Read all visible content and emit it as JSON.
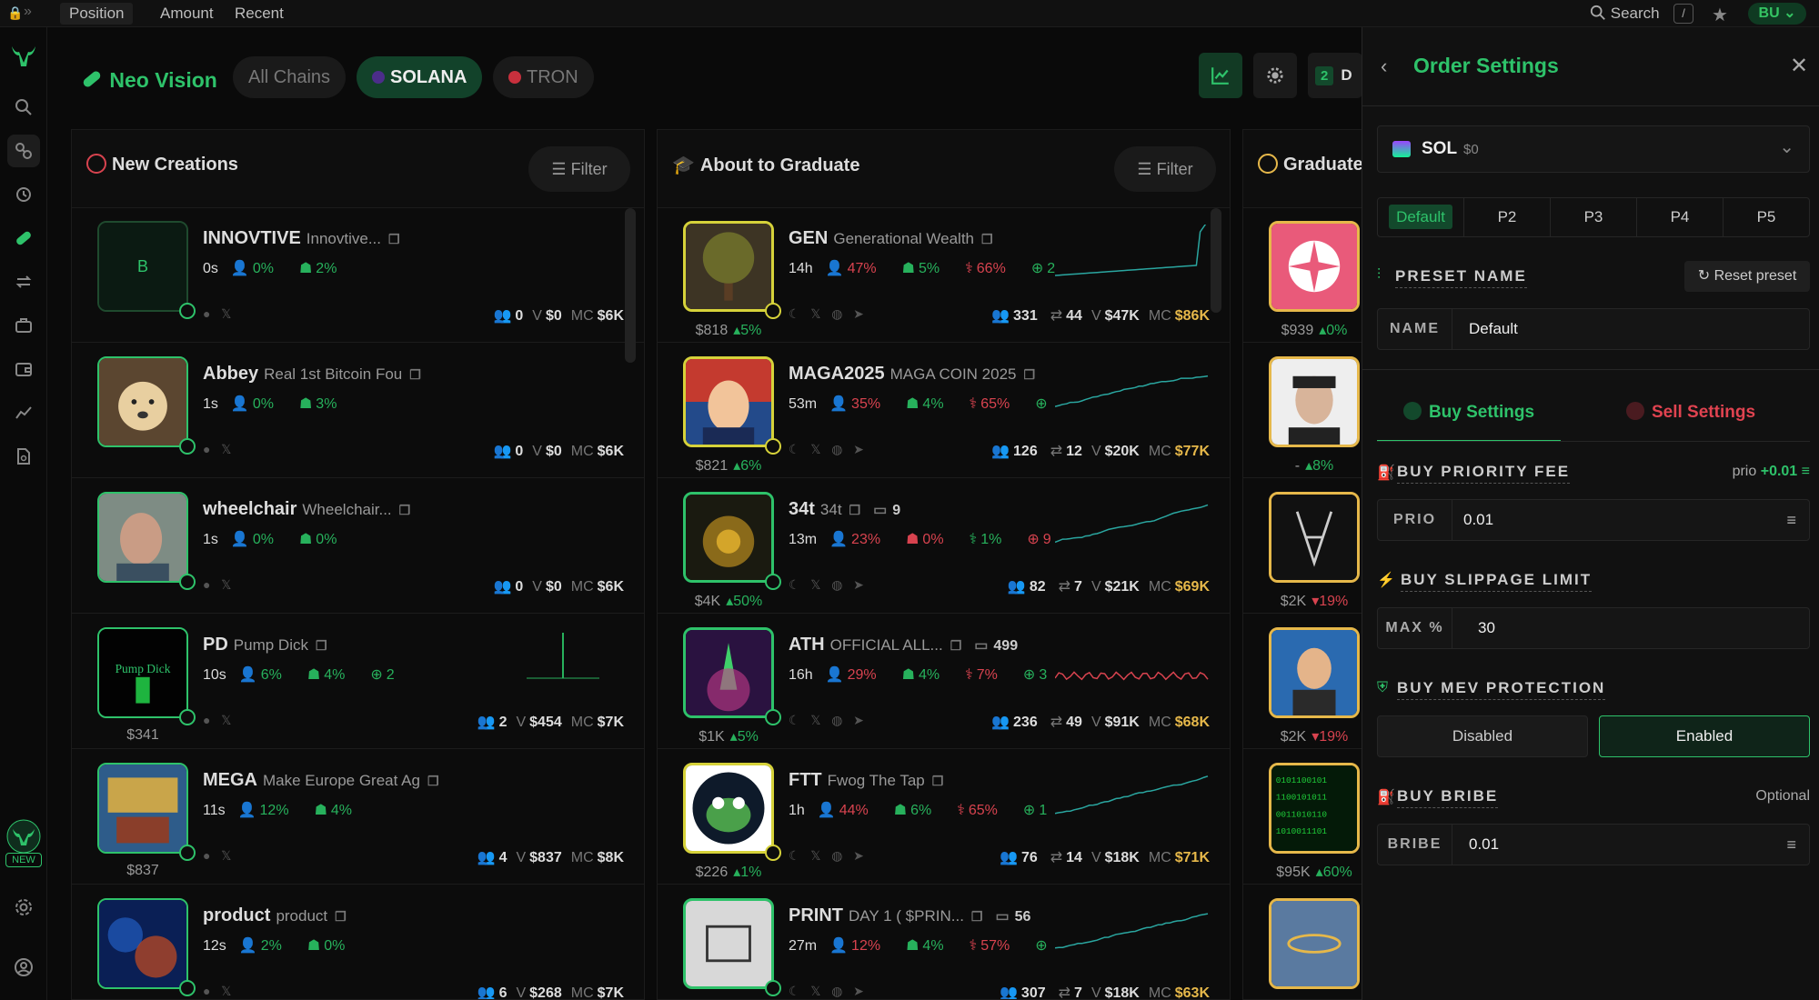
{
  "topbar": {
    "tabs": [
      "Position",
      "Amount",
      "Recent"
    ],
    "search_label": "Search",
    "search_shortcut": "/",
    "user_label": "BU"
  },
  "header": {
    "brand": "Neo Vision",
    "chains": [
      "All Chains",
      "SOLANA",
      "TRON"
    ],
    "count_badge": "2",
    "count_label": "D"
  },
  "columns": [
    {
      "title": "New Creations",
      "filter_label": "Filter"
    },
    {
      "title": "About to Graduate",
      "filter_label": "Filter"
    },
    {
      "title": "Graduate",
      "filter_label": ""
    }
  ],
  "new_creations": [
    {
      "symbol": "INNOVTIVE",
      "name": "Innovtive...",
      "age": "0s",
      "holders_pct": "0%",
      "dev_pct": "2%",
      "extra": "",
      "holders": "0",
      "volume": "$0",
      "mc": "$6K",
      "price": "",
      "avatar_letter": "B"
    },
    {
      "symbol": "Abbey",
      "name": "Real 1st Bitcoin Fou",
      "age": "1s",
      "holders_pct": "0%",
      "dev_pct": "3%",
      "extra": "",
      "holders": "0",
      "volume": "$0",
      "mc": "$6K",
      "price": "",
      "avatar_letter": ""
    },
    {
      "symbol": "wheelchair",
      "name": "Wheelchair...",
      "age": "1s",
      "holders_pct": "0%",
      "dev_pct": "0%",
      "extra": "",
      "holders": "0",
      "volume": "$0",
      "mc": "$6K",
      "price": "",
      "avatar_letter": ""
    },
    {
      "symbol": "PD",
      "name": "Pump Dick",
      "age": "10s",
      "holders_pct": "6%",
      "dev_pct": "4%",
      "extra": "2",
      "holders": "2",
      "volume": "$454",
      "mc": "$7K",
      "price": "$341",
      "avatar_letter": ""
    },
    {
      "symbol": "MEGA",
      "name": "Make Europe Great Ag",
      "age": "11s",
      "holders_pct": "12%",
      "dev_pct": "4%",
      "extra": "",
      "holders": "4",
      "volume": "$837",
      "mc": "$8K",
      "price": "$837",
      "avatar_letter": ""
    },
    {
      "symbol": "product",
      "name": "product",
      "age": "12s",
      "holders_pct": "2%",
      "dev_pct": "0%",
      "extra": "",
      "holders": "6",
      "volume": "$268",
      "mc": "$7K",
      "price": "",
      "avatar_letter": ""
    }
  ],
  "graduating": [
    {
      "symbol": "GEN",
      "name": "Generational Wealth",
      "age": "14h",
      "p1": "47%",
      "p2": "5%",
      "p3": "66%",
      "p4": "2",
      "holders": "331",
      "tx": "44",
      "volume": "$47K",
      "mc": "$86K",
      "price": "$818",
      "change": "5%"
    },
    {
      "symbol": "MAGA2025",
      "name": "MAGA COIN 2025",
      "age": "53m",
      "p1": "35%",
      "p2": "4%",
      "p3": "65%",
      "p4": "",
      "holders": "126",
      "tx": "12",
      "volume": "$20K",
      "mc": "$77K",
      "price": "$821",
      "change": "6%"
    },
    {
      "symbol": "34t",
      "name": "34t",
      "age": "13m",
      "p1": "23%",
      "p2": "0%",
      "p3": "1%",
      "p4": "9",
      "holders": "82",
      "tx": "7",
      "volume": "$21K",
      "mc": "$69K",
      "price": "$4K",
      "change": "50%",
      "comments": "9"
    },
    {
      "symbol": "ATH",
      "name": "OFFICIAL ALL...",
      "age": "16h",
      "p1": "29%",
      "p2": "4%",
      "p3": "7%",
      "p4": "3",
      "holders": "236",
      "tx": "49",
      "volume": "$91K",
      "mc": "$68K",
      "price": "$1K",
      "change": "5%",
      "comments": "499"
    },
    {
      "symbol": "FTT",
      "name": "Fwog The Tap",
      "age": "1h",
      "p1": "44%",
      "p2": "6%",
      "p3": "65%",
      "p4": "1",
      "holders": "76",
      "tx": "14",
      "volume": "$18K",
      "mc": "$71K",
      "price": "$226",
      "change": "1%"
    },
    {
      "symbol": "PRINT",
      "name": "DAY 1 ( $PRIN...",
      "age": "27m",
      "p1": "12%",
      "p2": "4%",
      "p3": "57%",
      "p4": "",
      "holders": "307",
      "tx": "7",
      "volume": "$18K",
      "mc": "$63K",
      "price": "",
      "change": "",
      "comments": "56"
    }
  ],
  "graduated": [
    {
      "price": "$939",
      "change": "0%"
    },
    {
      "price": "-",
      "change": "8%"
    },
    {
      "price": "$2K",
      "change": "19%"
    },
    {
      "price": "$2K",
      "change": "19%"
    },
    {
      "price": "$95K",
      "change": "60%"
    },
    {
      "price": "",
      "change": ""
    }
  ],
  "order_settings": {
    "title": "Order Settings",
    "token": {
      "symbol": "SOL",
      "balance": "$0"
    },
    "presets": [
      "Default",
      "P2",
      "P3",
      "P4",
      "P5"
    ],
    "preset_name_label": "PRESET NAME",
    "reset_label": "Reset preset",
    "name_label": "NAME",
    "name_value": "Default",
    "tabs": {
      "buy": "Buy Settings",
      "sell": "Sell Settings"
    },
    "priority": {
      "label": "BUY PRIORITY FEE",
      "hint": "prio",
      "hint_value": "+0.01",
      "field_label": "PRIO",
      "value": "0.01"
    },
    "slippage": {
      "label": "BUY SLIPPAGE LIMIT",
      "field_label": "MAX %",
      "value": "30"
    },
    "mev": {
      "label": "BUY MEV PROTECTION",
      "disabled": "Disabled",
      "enabled": "Enabled"
    },
    "bribe": {
      "label": "BUY BRIBE",
      "hint": "Optional",
      "field_label": "BRIBE",
      "value": "0.01"
    }
  },
  "colors": {
    "accent": "#2ec26a",
    "red": "#d8434f",
    "gold": "#e6b84a"
  },
  "sidebar_icons": [
    "logo-bull-icon",
    "search-icon",
    "link-icon",
    "history-icon",
    "pill-icon",
    "swap-icon",
    "briefcase-icon",
    "wallet-icon",
    "chart-icon",
    "document-search-icon",
    "new-bull-icon",
    "gear-icon",
    "user-icon"
  ],
  "new_badge": "NEW"
}
